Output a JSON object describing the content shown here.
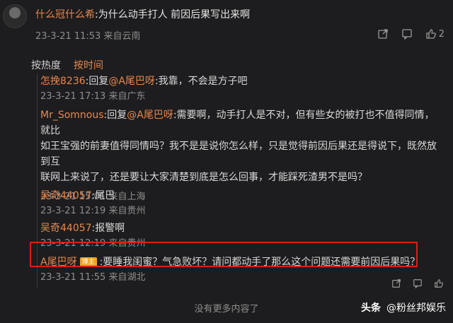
{
  "top": {
    "username": "什么冠什么希",
    "text": ":为什么动手打人 前因后果写出来啊",
    "date": "23-3-21 11:53",
    "location": "来自云南",
    "likes": "2"
  },
  "sort": {
    "hot": "按热度",
    "time": "按时间"
  },
  "replies": [
    {
      "user": "怎挽8236",
      "prefix": ":回复",
      "mention": "@A尾巴呀",
      "text": ":我靠，不会是方子吧",
      "date": "23-3-21 17:13",
      "location": "来自广东"
    },
    {
      "user": "Mr_Somnous",
      "prefix": ":回复",
      "mention": "@A尾巴呀",
      "text": ":需要啊，动手打人是不对，但有些女的被打也不值得同情，就比",
      "text2": "如王宝强的前妻值得同情吗？我不是是说你怎么样，只是觉得前因后果还是得说下，既然放到互",
      "text3": "联网上来说了，还是要让大家清楚到底是怎么回事，才能踩死渣男不是吗？",
      "date": "23-3-21 15:01",
      "location": "来自上海"
    },
    {
      "user": "吴奇44057",
      "text": ":尾巴",
      "date": "23-3-21 12:19",
      "location": "来自贵州"
    },
    {
      "user": "吴奇44057",
      "text": ":报警啊",
      "date": "23-3-21 12:19",
      "location": "来自贵州"
    },
    {
      "user": "A尾巴呀",
      "badge": "博主",
      "text": ":要睡我闺蜜？气急败坏？请问都动手了那么这个问题还需要前因后果吗？",
      "date": "23-3-21 11:55",
      "location": "来自湖北"
    }
  ],
  "footer": "没有更多内容了",
  "watermark": {
    "brand": "头条",
    "account": "@粉丝邦娱乐"
  }
}
